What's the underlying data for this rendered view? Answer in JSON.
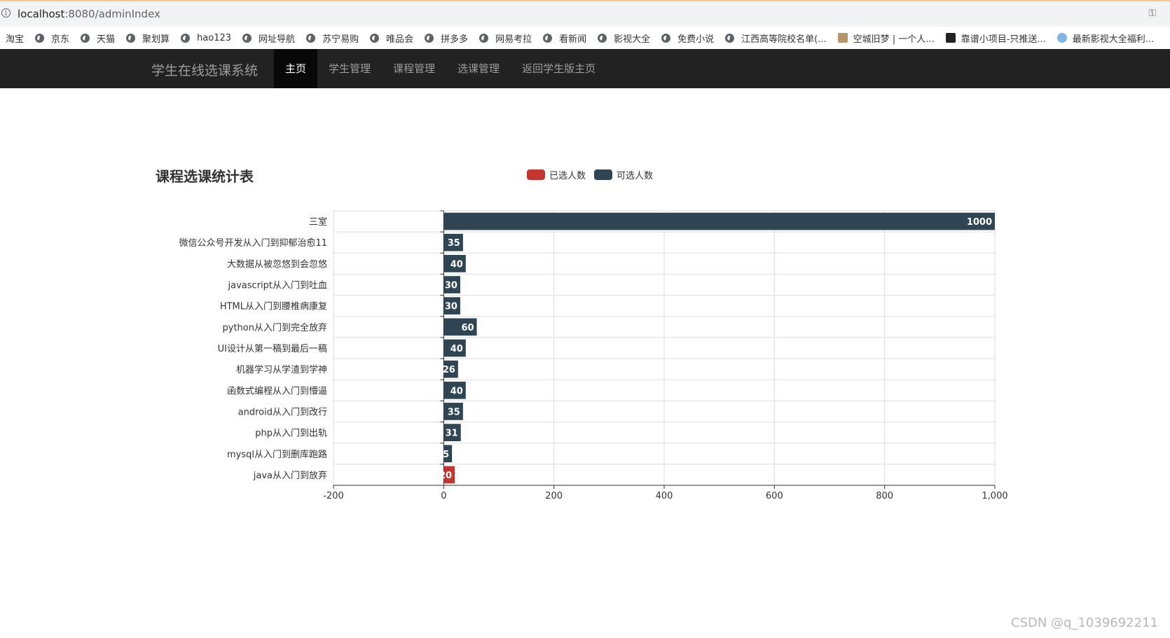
{
  "browser": {
    "url_host": "localhost",
    "url_path": ":8080/adminIndex",
    "bookmarks": [
      {
        "label": "淘宝",
        "icon": "none"
      },
      {
        "label": "京东",
        "icon": "globe-icon"
      },
      {
        "label": "天猫",
        "icon": "globe-icon"
      },
      {
        "label": "聚划算",
        "icon": "globe-icon"
      },
      {
        "label": "hao123",
        "icon": "globe-icon"
      },
      {
        "label": "网址导航",
        "icon": "globe-icon"
      },
      {
        "label": "苏宁易购",
        "icon": "globe-icon"
      },
      {
        "label": "唯品会",
        "icon": "globe-icon"
      },
      {
        "label": "拼多多",
        "icon": "globe-icon"
      },
      {
        "label": "网易考拉",
        "icon": "globe-icon"
      },
      {
        "label": "看新闻",
        "icon": "globe-icon"
      },
      {
        "label": "影视大全",
        "icon": "globe-icon"
      },
      {
        "label": "免费小说",
        "icon": "globe-icon"
      },
      {
        "label": "江西高等院校名单(...",
        "icon": "globe-icon"
      },
      {
        "label": "空城旧梦 | 一个人...",
        "icon": "image-icon"
      },
      {
        "label": "靠谱小项目-只推送...",
        "icon": "x-icon"
      },
      {
        "label": "最新影视大全福利...",
        "icon": "blue-icon"
      }
    ]
  },
  "navbar": {
    "brand": "学生在线选课系统",
    "items": [
      {
        "label": "主页",
        "active": true
      },
      {
        "label": "学生管理",
        "active": false
      },
      {
        "label": "课程管理",
        "active": false
      },
      {
        "label": "选课管理",
        "active": false
      },
      {
        "label": "返回学生版主页",
        "active": false
      }
    ]
  },
  "chart_data": {
    "type": "bar",
    "orientation": "horizontal",
    "title": "课程选课统计表",
    "categories": [
      "三室",
      "微信公众号开发从入门到抑郁治愈11",
      "大数据从被忽悠到会忽悠",
      "javascript从入门到吐血",
      "HTML从入门到腰椎病康复",
      "python从入门到完全放弃",
      "UI设计从第一稿到最后一稿",
      "机器学习从学渣到学神",
      "函数式编程从入门到懵逼",
      "android从入门到改行",
      "php从入门到出轨",
      "mysql从入门到删库跑路",
      "java从入门到放弃"
    ],
    "series": [
      {
        "name": "已选人数",
        "color": "#c23531",
        "values": [
          0,
          0,
          0,
          0,
          0,
          0,
          0,
          0,
          0,
          0,
          0,
          5,
          20
        ]
      },
      {
        "name": "可选人数",
        "color": "#2f4554",
        "values": [
          1000,
          35,
          40,
          30,
          30,
          60,
          40,
          26,
          40,
          35,
          31,
          15,
          0
        ]
      }
    ],
    "xlim": [
      -200,
      1000
    ],
    "xticks": [
      "-200",
      "0",
      "200",
      "400",
      "600",
      "800",
      "1,000"
    ],
    "legend_position": "top-center",
    "grid": true
  },
  "watermark": "CSDN @q_1039692211"
}
